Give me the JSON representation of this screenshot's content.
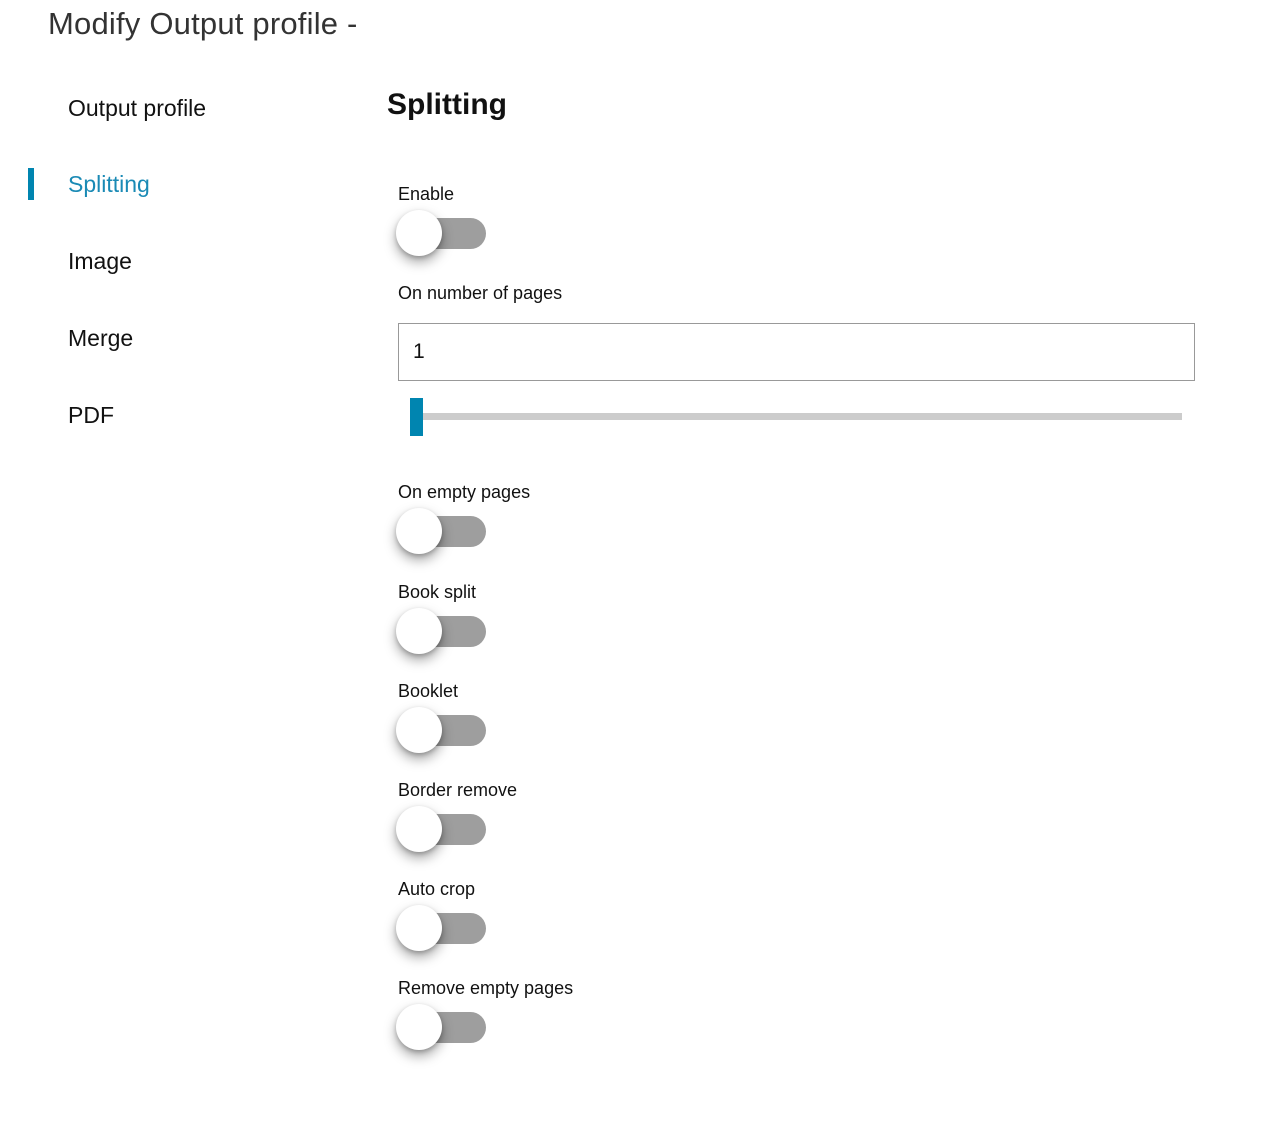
{
  "header": {
    "title": "Modify Output profile -"
  },
  "sidebar": {
    "active_index": 1,
    "accent_color": "#0085b0",
    "items": [
      {
        "label": "Output profile"
      },
      {
        "label": "Splitting"
      },
      {
        "label": "Image"
      },
      {
        "label": "Merge"
      },
      {
        "label": "PDF"
      }
    ]
  },
  "main": {
    "section_title": "Splitting",
    "enable": {
      "label": "Enable",
      "checked": false
    },
    "pages": {
      "label": "On number of pages",
      "value": "1",
      "slider_value": 1,
      "slider_fraction": 0.0
    },
    "toggles": [
      {
        "label": "On empty pages",
        "checked": false
      },
      {
        "label": "Book split",
        "checked": false
      },
      {
        "label": "Booklet",
        "checked": false
      },
      {
        "label": "Border remove",
        "checked": false
      },
      {
        "label": "Auto crop",
        "checked": false
      },
      {
        "label": "Remove empty pages",
        "checked": false
      }
    ]
  }
}
